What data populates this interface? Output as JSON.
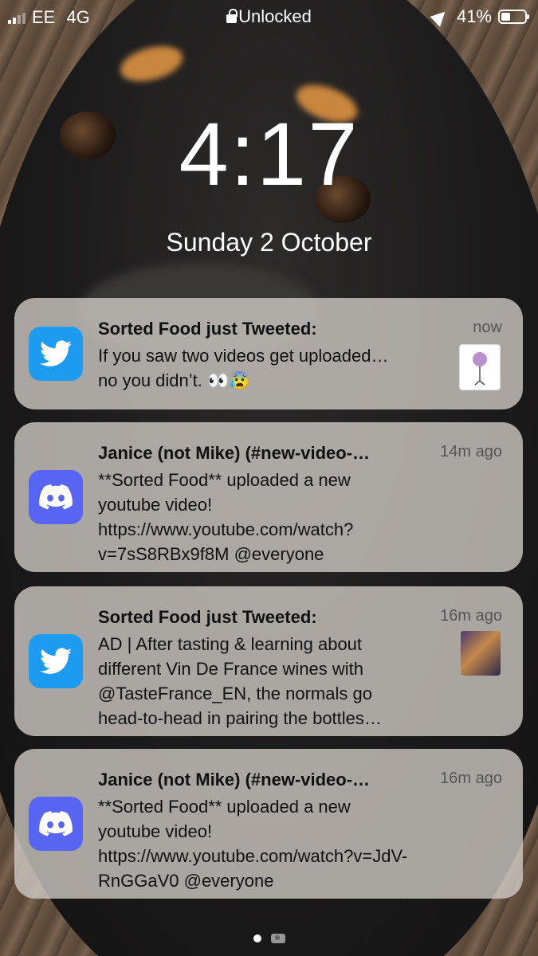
{
  "status_bar": {
    "carrier": "EE",
    "network": "4G",
    "lock_status": "Unlocked",
    "battery_percent": "41%",
    "battery_level": 0.41
  },
  "lock_screen": {
    "time": "4:17",
    "date": "Sunday 2 October"
  },
  "notifications": [
    {
      "app": "twitter",
      "icon": "twitter-bird-icon",
      "title": "Sorted Food just Tweeted:",
      "time": "now",
      "body": "If you saw two videos get uploaded…\nno you didn’t. 👀😰",
      "has_thumbnail": true
    },
    {
      "app": "discord",
      "icon": "discord-icon",
      "title": "Janice (not Mike) (#new-video-…",
      "time": "14m ago",
      "body": "**Sorted Food** uploaded a new\nyoutube video!\nhttps://www.youtube.com/watch?\nv=7sS8RBx9f8M @everyone",
      "has_thumbnail": false
    },
    {
      "app": "twitter",
      "icon": "twitter-bird-icon",
      "title": "Sorted Food just Tweeted:",
      "time": "16m ago",
      "body": "AD | After tasting & learning about\ndifferent Vin De France wines with\n@TasteFrance_EN, the normals go\nhead-to-head in pairing the bottles…",
      "has_thumbnail": true
    },
    {
      "app": "discord",
      "icon": "discord-icon",
      "title": "Janice (not Mike) (#new-video-…",
      "time": "16m ago",
      "body": "**Sorted Food** uploaded a new\nyoutube video!\nhttps://www.youtube.com/watch?v=JdV-\nRnGGaV0 @everyone",
      "has_thumbnail": false
    }
  ],
  "colors": {
    "twitter": "#1d9bf0",
    "discord": "#5865f2"
  }
}
